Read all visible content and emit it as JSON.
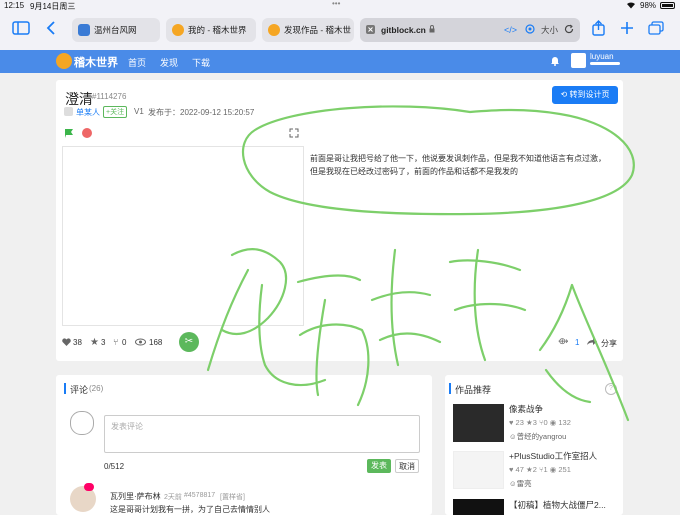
{
  "status": {
    "time": "12:15",
    "date": "9月14日周三",
    "dots": "•••",
    "battery": "98%"
  },
  "tabs": [
    {
      "label": "温州台风网",
      "fav_color": "#3a7bd5"
    },
    {
      "label": "我的 - 稽木世界",
      "fav_color": "#f5a623"
    },
    {
      "label": "发现作品 - 稽木世",
      "fav_color": "#f5a623"
    }
  ],
  "address": {
    "url": "gitblock.cn",
    "text_size": "大小"
  },
  "nav": {
    "logo": "稽木世界",
    "links": [
      "首页",
      "发现",
      "下载"
    ],
    "username": "luyuan"
  },
  "project": {
    "title": "澄清",
    "id": "#1114276",
    "author": "单某人",
    "follow": "+关注",
    "version": "V1",
    "published": "发布于：2022-09-12 15:20:57",
    "design_button": "转到设计页",
    "description": "前面是哥让我把号给了他一下，他说要发讽刺作品，但是我不知道他语言有点过激，但是我现在已经改过密码了，前面的作品和话都不是我发的",
    "stats": {
      "likes": "38",
      "stars": "3",
      "forks": "0",
      "views": "168"
    },
    "remix_count": "1",
    "share": "分享"
  },
  "comments": {
    "title": "评论",
    "count": "(26)",
    "placeholder": "发表评论",
    "counter": "0/512",
    "submit": "发表",
    "cancel": "取消",
    "first": {
      "name": "瓦列里·萨布林",
      "time": "2天前",
      "id": "#4578817",
      "tag": "[置样省]",
      "text": "这是哥哥计划我有一拼，为了自己去情情别人"
    }
  },
  "recommend": {
    "title": "作品推荐",
    "help": "?",
    "items": [
      {
        "title": "像素战争",
        "likes": "23",
        "stars": "3",
        "forks": "0",
        "views": "132",
        "author": "曾经的yangrou",
        "thumb_color": "#2a2a2a"
      },
      {
        "title": "+PlusStudio工作室招人",
        "likes": "47",
        "stars": "2",
        "forks": "1",
        "views": "251",
        "author": "雷亮",
        "thumb_color": "#f4f4f4"
      },
      {
        "title": "【初稿】植物大战僵尸2...",
        "likes": "",
        "stars": "",
        "forks": "",
        "views": "",
        "author": "",
        "thumb_color": "#111111"
      }
    ]
  },
  "colors": {
    "brand": "#4a8be8",
    "green": "#5cb85c",
    "link": "#1a7cf5",
    "scribble": "#7dcf6a"
  }
}
